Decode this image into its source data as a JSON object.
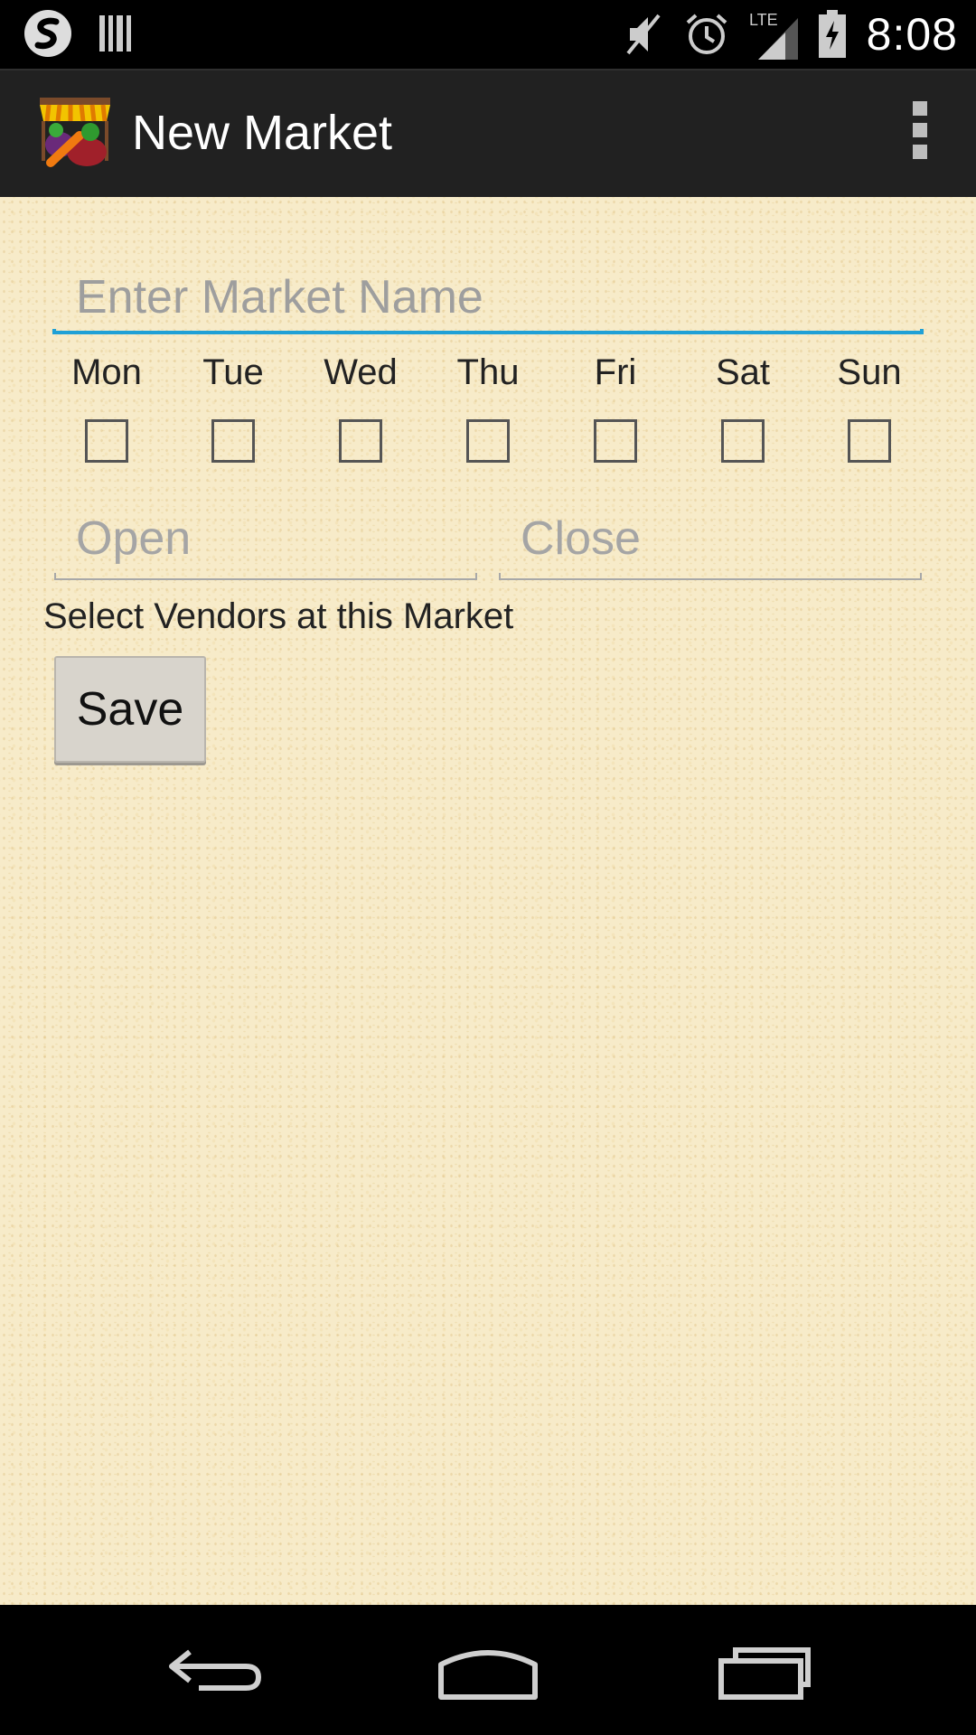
{
  "status_bar": {
    "time": "8:08",
    "network_label": "LTE",
    "icons": [
      "swype-icon",
      "barcode-icon",
      "mute-icon",
      "alarm-icon",
      "signal-icon",
      "battery-charging-icon"
    ]
  },
  "action_bar": {
    "title": "New Market",
    "app_icon": "market-stall-icon",
    "overflow_icon": "overflow-menu-icon"
  },
  "form": {
    "name_placeholder": "Enter Market Name",
    "name_value": "",
    "days": [
      {
        "label": "Mon",
        "checked": false
      },
      {
        "label": "Tue",
        "checked": false
      },
      {
        "label": "Wed",
        "checked": false
      },
      {
        "label": "Thu",
        "checked": false
      },
      {
        "label": "Fri",
        "checked": false
      },
      {
        "label": "Sat",
        "checked": false
      },
      {
        "label": "Sun",
        "checked": false
      }
    ],
    "open_placeholder": "Open",
    "close_placeholder": "Close",
    "vendors_label": "Select Vendors at this Market",
    "save_label": "Save"
  },
  "colors": {
    "accent_underline": "#1fa0d6",
    "background": "#f7ebc9",
    "action_bar": "#212121"
  },
  "nav_bar": {
    "icons": [
      "back-icon",
      "home-icon",
      "recents-icon"
    ]
  }
}
